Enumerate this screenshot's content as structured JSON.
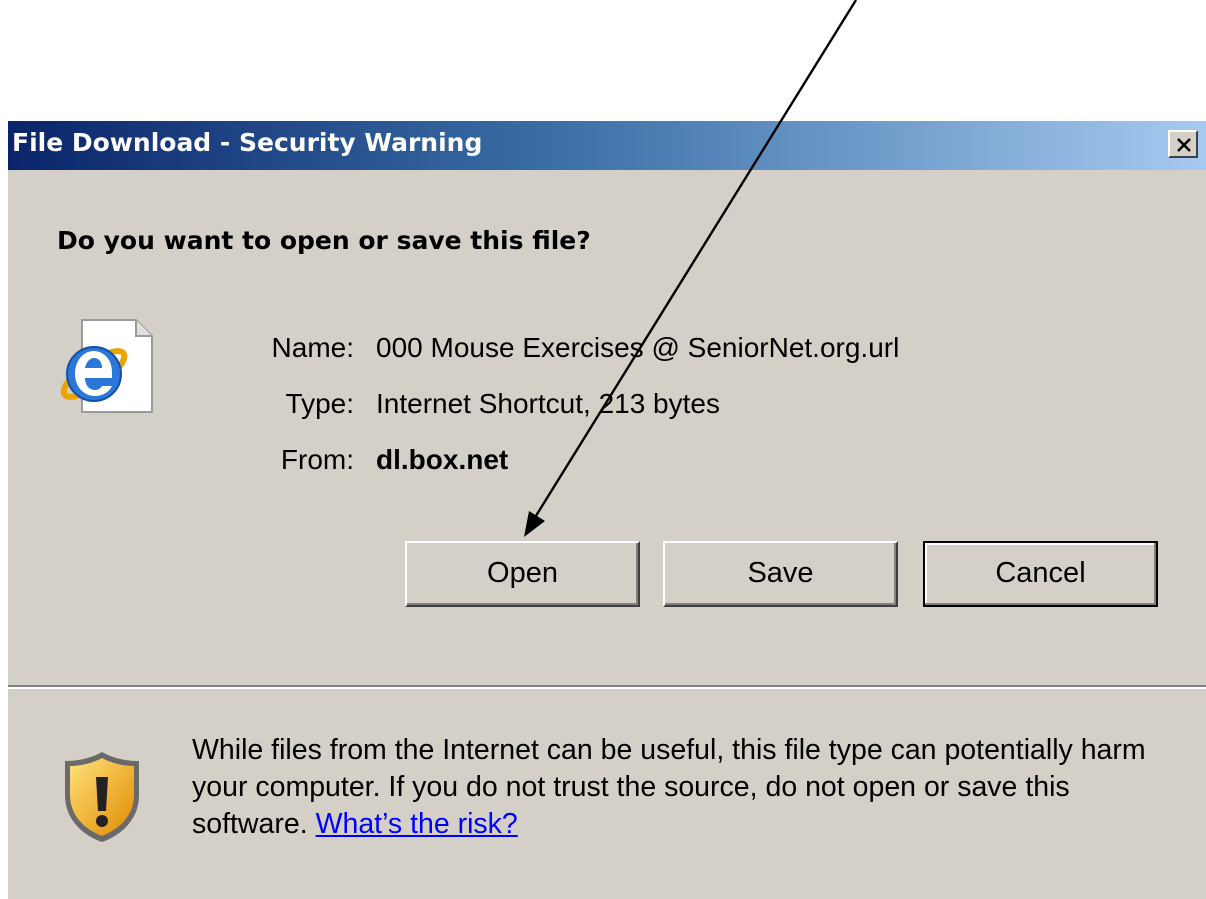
{
  "dialog": {
    "title": "File Download - Security Warning",
    "close_icon": "close-x-icon",
    "question": "Do you want to open or save this file?",
    "file_icon": "internet-explorer-shortcut-icon",
    "info": {
      "name_label": "Name:",
      "name_value": "000 Mouse Exercises @ SeniorNet.org.url",
      "type_label": "Type:",
      "type_value": "Internet Shortcut, 213 bytes",
      "from_label": "From:",
      "from_value": "dl.box.net"
    },
    "buttons": {
      "open": "Open",
      "save": "Save",
      "cancel": "Cancel"
    },
    "warning": {
      "icon": "security-shield-warning-icon",
      "text": "While files from the Internet can be useful, this file type can potentially harm your computer. If you do not trust the source, do not open or save this software.",
      "link": "What’s the risk?"
    }
  },
  "annotation": {
    "icon": "pointer-arrow-annotation"
  },
  "colors": {
    "titlebar_start": "#0a246a",
    "titlebar_end": "#a6caf0",
    "dialog_bg": "#d4d0c8",
    "link": "#0000ff"
  }
}
